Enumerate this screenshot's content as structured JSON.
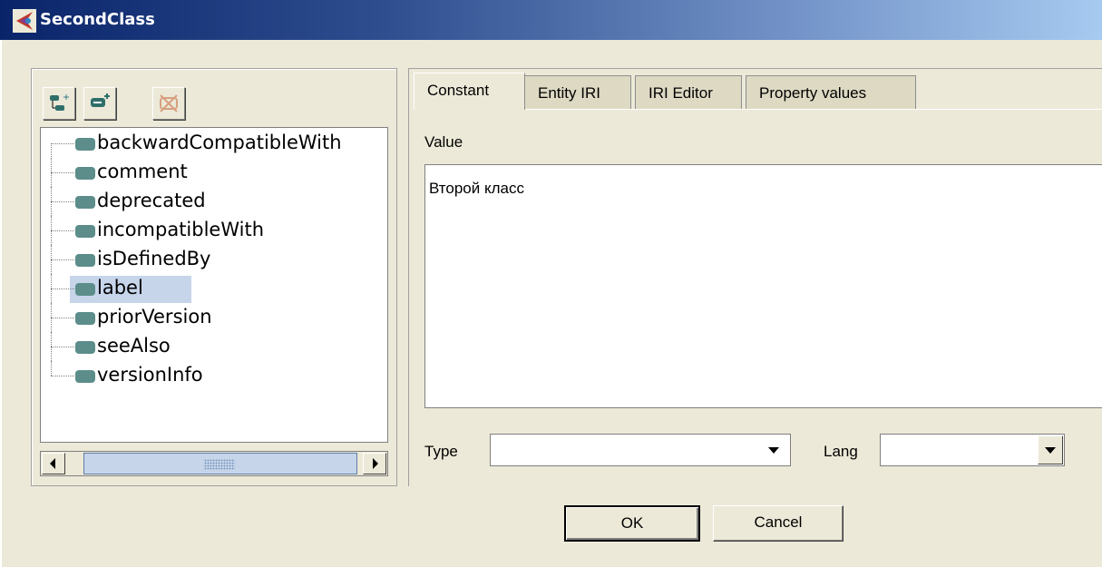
{
  "window": {
    "title": "SecondClass",
    "app_icon": "protege-icon"
  },
  "toolbar": {
    "buttons": [
      {
        "icon": "add-subproperty-icon"
      },
      {
        "icon": "add-property-icon"
      },
      {
        "icon": "delete-icon"
      }
    ]
  },
  "tree": {
    "items": [
      {
        "label": "backwardCompatibleWith",
        "selected": false
      },
      {
        "label": "comment",
        "selected": false
      },
      {
        "label": "deprecated",
        "selected": false
      },
      {
        "label": "incompatibleWith",
        "selected": false
      },
      {
        "label": "isDefinedBy",
        "selected": false
      },
      {
        "label": "label",
        "selected": true
      },
      {
        "label": "priorVersion",
        "selected": false
      },
      {
        "label": "seeAlso",
        "selected": false
      },
      {
        "label": "versionInfo",
        "selected": false
      }
    ]
  },
  "tabs": [
    {
      "label": "Constant",
      "active": true
    },
    {
      "label": "Entity IRI",
      "active": false
    },
    {
      "label": "IRI Editor",
      "active": false
    },
    {
      "label": "Property values",
      "active": false
    }
  ],
  "editor": {
    "value_label": "Value",
    "value_text": "Второй класс",
    "type_label": "Type",
    "type_value": "",
    "lang_label": "Lang",
    "lang_value": ""
  },
  "buttons": {
    "ok": "OK",
    "cancel": "Cancel"
  },
  "colors": {
    "titlebar_start": "#0a246a",
    "titlebar_end": "#a6caf0",
    "selection": "#c6d5ea",
    "node_icon": "#5c8d8a",
    "window_bg": "#ece9d8"
  }
}
